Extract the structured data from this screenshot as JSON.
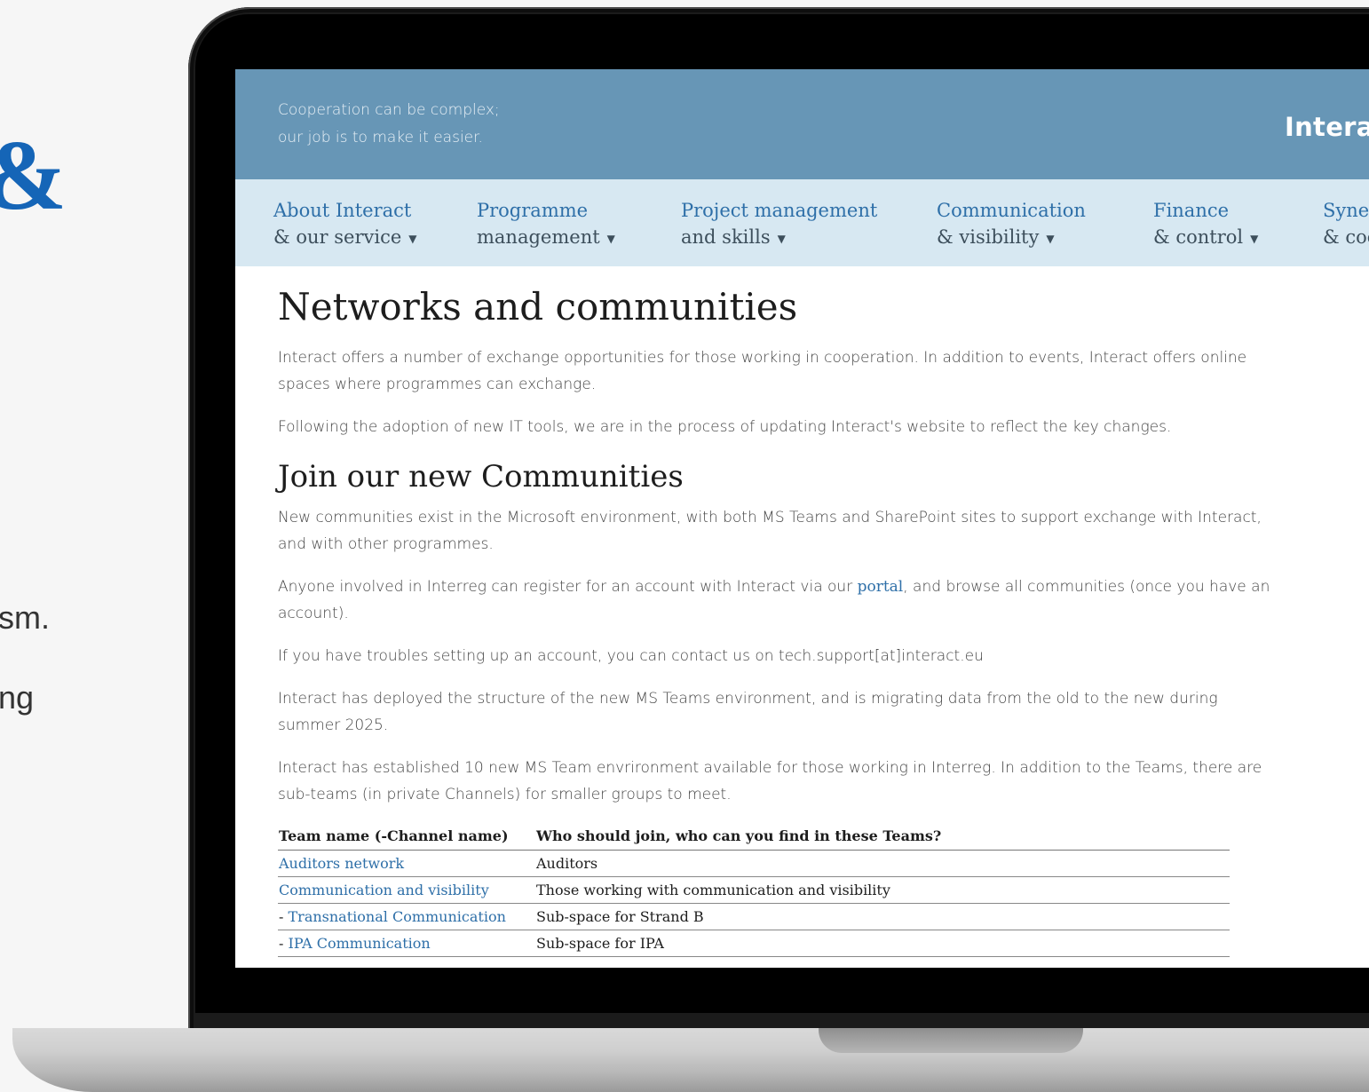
{
  "background_fragments": {
    "ampersand": "&",
    "frag1": "sm.",
    "frag2": "ng"
  },
  "banner": {
    "tagline_line1": "Cooperation can be complex;",
    "tagline_line2": "our job is to make it easier.",
    "logo_text": "Intera"
  },
  "nav": {
    "items": [
      {
        "top": "About Interact",
        "bottom": "& our service"
      },
      {
        "top": "Programme",
        "bottom": "management"
      },
      {
        "top": "Project management",
        "bottom": "and skills"
      },
      {
        "top": "Communication",
        "bottom": "& visibility"
      },
      {
        "top": "Finance",
        "bottom": "& control"
      },
      {
        "top": "Syne",
        "bottom": "& coc"
      }
    ]
  },
  "content": {
    "title": "Networks and communities",
    "intro": "Interact offers a number of exchange opportunities for those working in cooperation. In addition to events, Interact offers online spaces where programmes can exchange.",
    "update_note": "Following the adoption of new IT tools, we are in the process of updating Interact's website to reflect the key changes.",
    "section_title": "Join our new Communities",
    "para_communities": "New communities exist in the Microsoft environment, with both MS Teams and SharePoint sites to support exchange with Interact, and with other programmes.",
    "para_register_before": "Anyone involved in Interreg can register for an account with Interact via our ",
    "para_register_link": "portal",
    "para_register_after": ", and browse all communities (once you have an account).",
    "para_support": "If you have troubles setting up an account, you can contact us on tech.support[at]interact.eu",
    "para_migration": "Interact has deployed the structure of the new MS Teams environment, and is migrating data from the old to the new during summer 2025.",
    "para_teams": "Interact has established 10 new MS Team envrironment available for those working in Interreg. In addition to the Teams, there are sub-teams (in private Channels) for smaller groups to meet."
  },
  "table": {
    "headers": [
      "Team name (-Channel name)",
      "Who should join, who can you find in these Teams?"
    ],
    "rows": [
      {
        "prefix": "",
        "name": "Auditors network",
        "desc": "Auditors"
      },
      {
        "prefix": "",
        "name": "Communication and visibility",
        "desc": "Those working with communication and visibility"
      },
      {
        "prefix": "- ",
        "name": "Transnational Communication",
        "desc": "Sub-space for Strand B"
      },
      {
        "prefix": "- ",
        "name": "IPA Communication",
        "desc": "Sub-space for IPA"
      }
    ]
  }
}
